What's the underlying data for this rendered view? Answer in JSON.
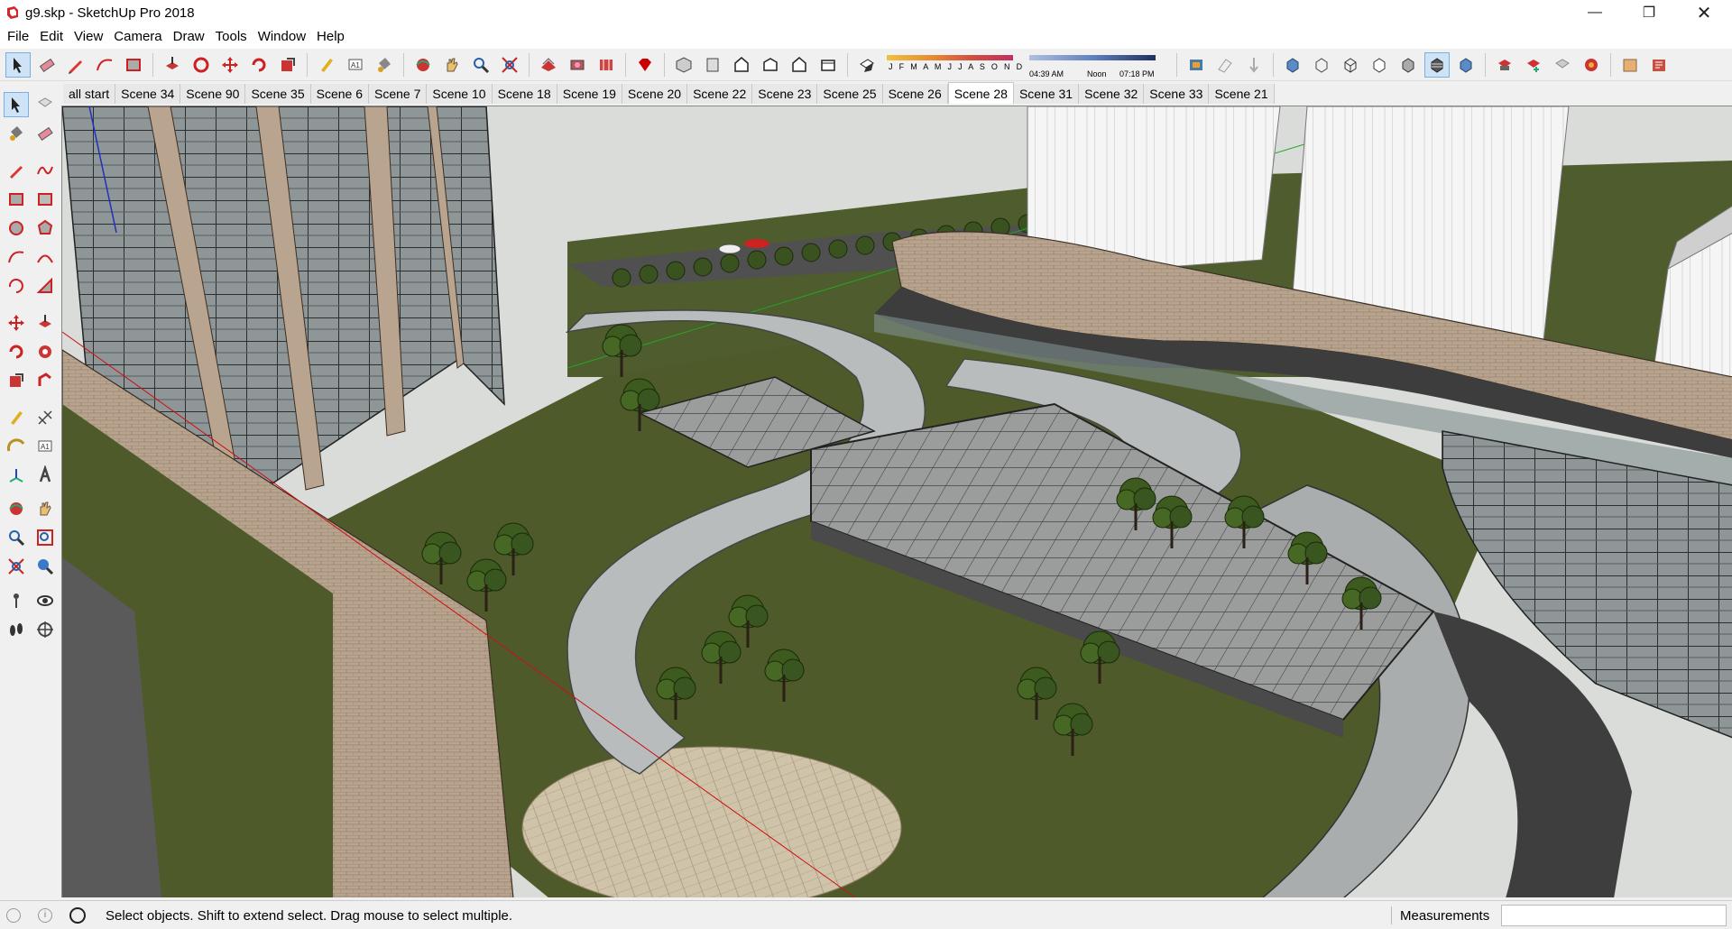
{
  "window": {
    "title": "g9.skp - SketchUp Pro 2018",
    "app_icon": "sketchup-logo-icon",
    "controls": [
      "minimize-icon",
      "restore-icon",
      "close-icon"
    ]
  },
  "menu": [
    "File",
    "Edit",
    "View",
    "Camera",
    "Draw",
    "Tools",
    "Window",
    "Help"
  ],
  "shadow": {
    "months": "J F M A M J J A S O N D",
    "time_start": "04:39 AM",
    "time_mid": "Noon",
    "time_end": "07:18 PM"
  },
  "scenes": {
    "active": "Scene 28",
    "tabs": [
      "all start",
      "Scene 34",
      "Scene 90",
      "Scene 35",
      "Scene 6",
      "Scene 7",
      "Scene 10",
      "Scene 18",
      "Scene 19",
      "Scene 20",
      "Scene 22",
      "Scene 23",
      "Scene 25",
      "Scene 26",
      "Scene 28",
      "Scene 31",
      "Scene 32",
      "Scene 33",
      "Scene 21"
    ]
  },
  "status": {
    "message": "Select objects. Shift to extend select. Drag mouse to select multiple.",
    "measurements_label": "Measurements",
    "measurements_value": ""
  },
  "colors": {
    "grass": "#4f5a2a",
    "paving": "#c9bca3",
    "glass": "#8d9597",
    "tower": "#7b7f80",
    "white_tower": "#f4f4f4",
    "sky": "#d9dcd8",
    "tree": "#3e5a1e"
  }
}
